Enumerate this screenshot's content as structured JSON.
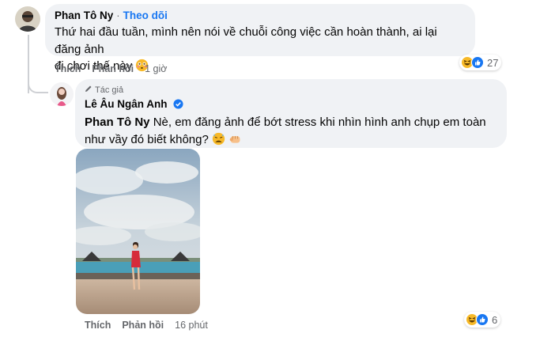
{
  "comment": {
    "author": "Phan Tô Ny",
    "separator": "·",
    "follow_label": "Theo dõi",
    "text_line1": "Thứ hai đầu tuần, mình nên nói về chuỗi công việc cần hoàn thành, ai lại đăng ảnh",
    "text_line2": "đi chơi thế này",
    "emoji": "flushed-face",
    "actions": {
      "like": "Thích",
      "reply": "Phản hồi",
      "time": "1 giờ"
    },
    "reactions": {
      "icons": [
        "haha-icon",
        "like-icon"
      ],
      "count": "27"
    }
  },
  "reply": {
    "author_badge": "Tác giả",
    "author": "Lê Âu Ngân Anh",
    "verified": true,
    "mention": "Phan Tô Ny",
    "text_line1": "Nè, em đăng ảnh để bớt stress khi nhìn hình anh chụp em toàn",
    "text_line2": "như vầy đó biết không?",
    "emojis": [
      "weary-face",
      "fist"
    ],
    "photo": "photo-woman-red-dress-by-pool",
    "actions": {
      "like": "Thích",
      "reply": "Phản hồi",
      "time": "16 phút"
    },
    "reactions": {
      "icons": [
        "haha-icon",
        "like-icon"
      ],
      "count": "6"
    }
  },
  "colors": {
    "link": "#1877f2",
    "bubble": "#f0f2f5",
    "muted": "#65676b",
    "haha": "#f7b928",
    "like": "#1877f2"
  }
}
